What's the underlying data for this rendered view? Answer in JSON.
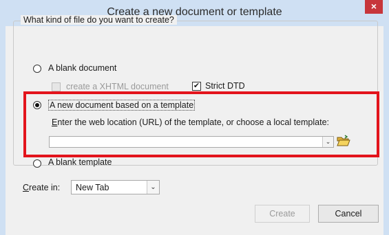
{
  "window": {
    "title": "Create a new document or template",
    "close_glyph": "×"
  },
  "group": {
    "legend": "What kind of file do you want to create?"
  },
  "options": {
    "blank_document": {
      "label": "A blank document",
      "checked": false
    },
    "xhtml": {
      "label": "create a XHTML document",
      "checked": false,
      "disabled": true
    },
    "strict_dtd": {
      "label": "Strict DTD",
      "checked": true,
      "check_glyph": "✔"
    },
    "template_doc": {
      "label": "A new document based on a template",
      "checked": true
    },
    "template_hint": "Enter the web location (URL) of the template, or choose a local template:",
    "template_url": {
      "value": "",
      "dropdown_glyph": "⌄"
    },
    "blank_template": {
      "label": "A blank template",
      "checked": false
    }
  },
  "create_in": {
    "label_underlined": "C",
    "label_rest": "reate in:",
    "selected": "New Tab",
    "arrow_glyph": "⌄"
  },
  "buttons": {
    "create": "Create",
    "cancel": "Cancel"
  },
  "colors": {
    "highlight": "#e3141c",
    "titlebar": "#cfe0f3",
    "close": "#c7363b"
  },
  "icons": {
    "folder": "open-folder-icon"
  }
}
